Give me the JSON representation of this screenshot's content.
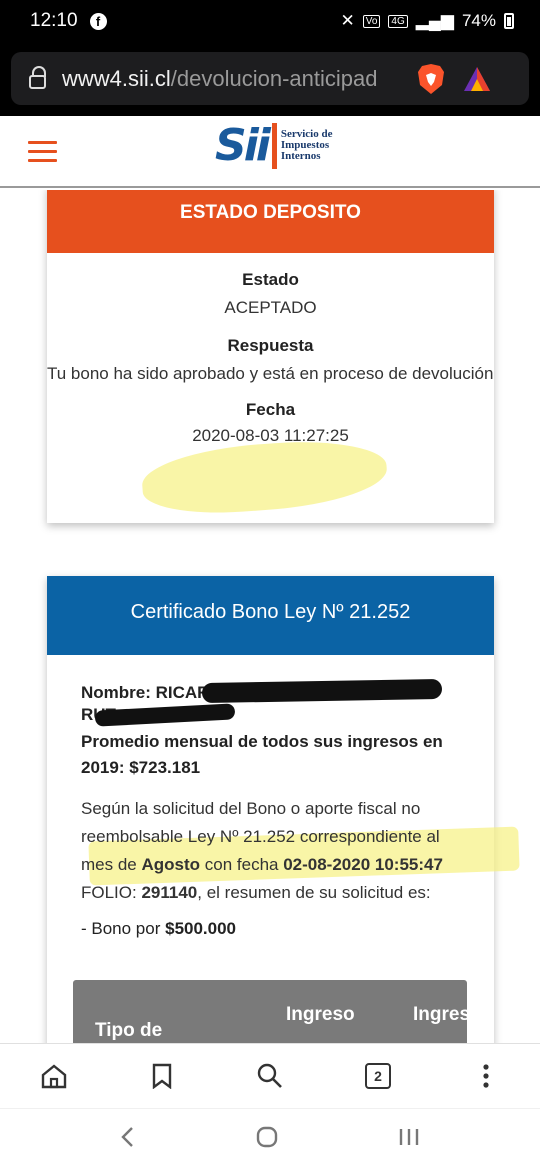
{
  "status_bar": {
    "time": "12:10",
    "battery": "74%"
  },
  "browser": {
    "url_host": "www4.sii.cl",
    "url_path": "/devolucion-anticipad",
    "tab_count": "2"
  },
  "site_header": {
    "logo_text": "Sii",
    "logo_line1": "Servicio de",
    "logo_line2": "Impuestos",
    "logo_line3": "Internos"
  },
  "estado_card": {
    "header": "ESTADO DEPOSITO",
    "estado_label": "Estado",
    "estado_value": "ACEPTADO",
    "respuesta_label": "Respuesta",
    "respuesta_value": "Tu bono ha sido aprobado y está en proceso de devolución",
    "fecha_label": "Fecha",
    "fecha_value": "2020-08-03 11:27:25"
  },
  "certificado_card": {
    "header": "Certificado Bono Ley Nº 21.252",
    "nombre_label": "Nombre: RICARDO",
    "rut_label": "RUT:",
    "promedio_label": "Promedio mensual de todos sus ingresos en 2019: $723.181",
    "p_text1": "Según la solicitud del Bono o aporte fiscal no reembolsable Ley Nº 21.252 correspondiente al mes de ",
    "p_mes": "Agosto",
    "p_text2": " con fecha ",
    "p_fecha": "02-08-2020 10:55:47",
    "p_folio_label": "FOLIO: ",
    "p_folio": "291140",
    "p_text3": ", el resumen de su solicitud es:",
    "bono_prefix": "- Bono por ",
    "bono_amount": "$500.000",
    "table_col1": "Tipo de",
    "table_col2": "Ingreso",
    "table_col3": "Ingres"
  },
  "colors": {
    "sii_orange": "#e6501e",
    "sii_blue": "#0b63a5",
    "highlight": "#f6f078"
  },
  "icons": [
    "home-icon",
    "bookmark-icon",
    "search-icon",
    "tabs-icon",
    "more-icon",
    "back-icon",
    "home-circle-icon",
    "recents-icon"
  ]
}
